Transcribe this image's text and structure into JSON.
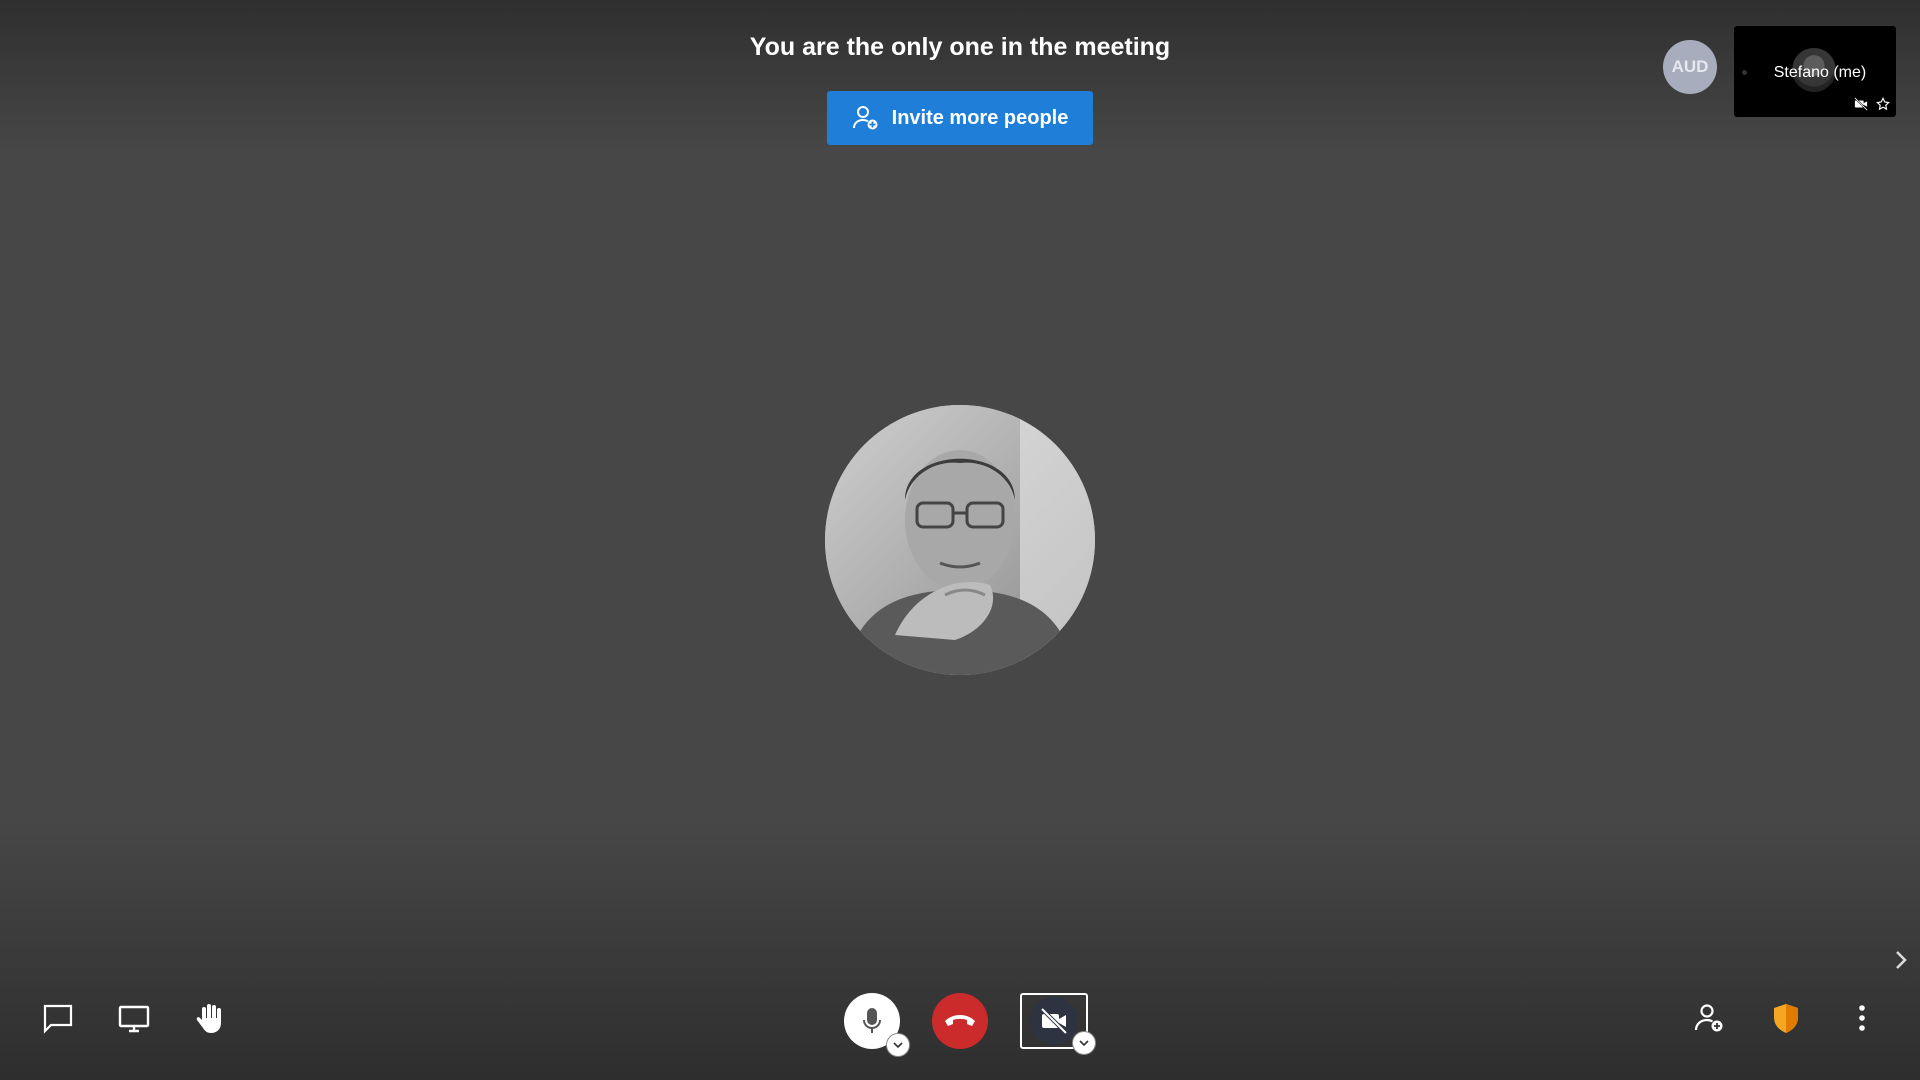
{
  "notice": {
    "title": "You are the only one in the meeting",
    "invite_label": "Invite more people"
  },
  "filmstrip": {
    "audience_avatar_initials": "AUD",
    "self_name": "Stefano (me)"
  },
  "toolbar": {
    "left": [
      "chat-icon",
      "screen-share-icon",
      "raise-hand-icon"
    ],
    "center": [
      "microphone-icon",
      "hangup-icon",
      "camera-off-icon"
    ],
    "right": [
      "invite-icon",
      "security-shield-icon",
      "more-options-icon"
    ]
  },
  "colors": {
    "invite_button": "#1f7fd8",
    "hangup": "#cc2b2b",
    "shield": "#f5a623"
  }
}
